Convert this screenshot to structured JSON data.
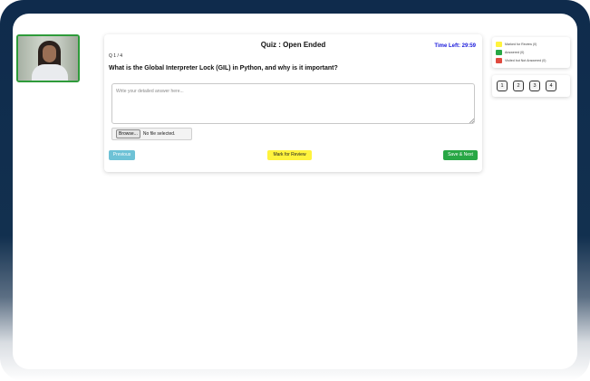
{
  "quiz": {
    "title": "Quiz : Open Ended",
    "time_left_label": "Time Left: 29:59",
    "question_counter": "Q 1 / 4",
    "question_text": "What is the Global Interpreter Lock (GIL) in Python, and why is it important?",
    "answer_placeholder": "Write your detailed answer here...",
    "browse_label": "Browse...",
    "file_status": "No file selected.",
    "previous_label": "Previous",
    "mark_review_label": "Mark for Review",
    "save_next_label": "Save & Next"
  },
  "legend": {
    "items": [
      {
        "label": "Marked for Review (0)",
        "color": "#fff33d"
      },
      {
        "label": "Answered (0)",
        "color": "#28a745"
      },
      {
        "label": "Visited but Not Answered (0)",
        "color": "#e04a3f"
      }
    ]
  },
  "question_nav": {
    "buttons": [
      "1",
      "2",
      "3",
      "4"
    ]
  },
  "colors": {
    "frame_dark": "#0f2b4c",
    "time_left": "#1a1adb",
    "webcam_border": "#2e9b3a"
  }
}
